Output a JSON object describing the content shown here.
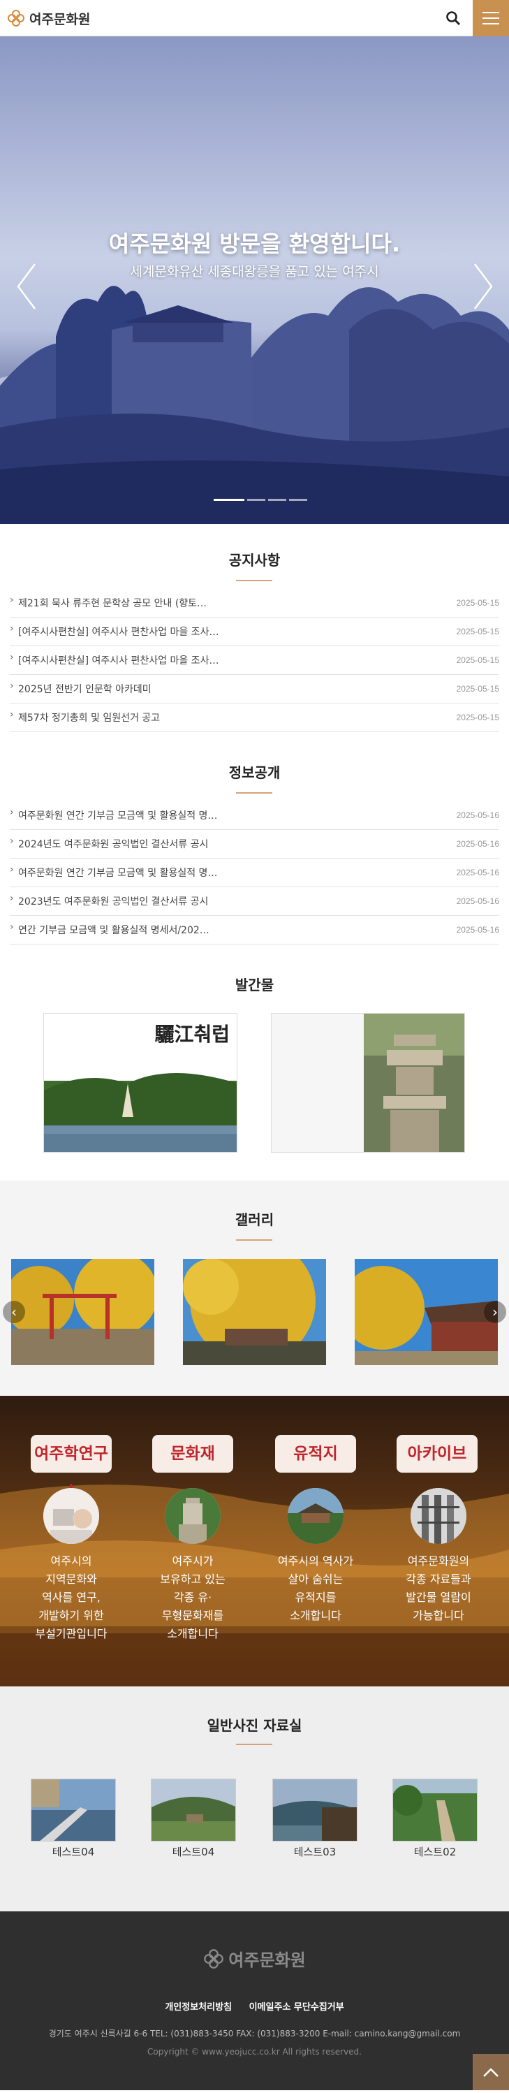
{
  "header": {
    "logo_text": "여주문화원"
  },
  "hero": {
    "title": "여주문화원 방문을 환영합니다.",
    "subtitle": "세계문화유산 세종대왕릉을 품고 있는 여주시"
  },
  "notice": {
    "title": "공지사항",
    "items": [
      {
        "t": "제21회 묵사 류주현 문학상 공모 안내 (향토…",
        "d": "2025-05-15"
      },
      {
        "t": "[여주시사편찬실] 여주시사 편찬사업 마을 조사…",
        "d": "2025-05-15"
      },
      {
        "t": "[여주시사편찬실] 여주시사 편찬사업 마을 조사…",
        "d": "2025-05-15"
      },
      {
        "t": "2025년 전반기 인문학 아카데미",
        "d": "2025-05-15"
      },
      {
        "t": "제57차 정기총회 및 임원선거 공고",
        "d": "2025-05-15"
      }
    ]
  },
  "info": {
    "title": "정보공개",
    "items": [
      {
        "t": "여주문화원 연간 기부금 모금액 및 활용실적 명…",
        "d": "2025-05-16"
      },
      {
        "t": "2024년도 여주문화원 공익법인 결산서류 공시",
        "d": "2025-05-16"
      },
      {
        "t": "여주문화원 연간 기부금 모금액 및 활용실적 명…",
        "d": "2025-05-16"
      },
      {
        "t": "2023년도 여주문화원 공익법인 결산서류 공시",
        "d": "2025-05-16"
      },
      {
        "t": "연간 기부금 모금액 및 활용실적 명세서/202…",
        "d": "2025-05-16"
      }
    ]
  },
  "pubs": {
    "title": "발간물",
    "cover_title": "驪江춰럽"
  },
  "gallery": {
    "title": "갤러리"
  },
  "categories": [
    {
      "label": "여주학연구소",
      "desc": "여주시의\n지역문화와\n역사를 연구,\n개발하기 위한\n부설기관입니다"
    },
    {
      "label": "문화재",
      "desc": "여주시가\n보유하고 있는\n각종 유·\n무형문화재를\n소개합니다"
    },
    {
      "label": "유적지",
      "desc": "여주시의 역사가\n살아 숨쉬는\n유적지를\n소개합니다"
    },
    {
      "label": "아카이브",
      "desc": "여주문화원의\n각종 자료들과\n발간물 열람이\n가능합니다"
    }
  ],
  "photos": {
    "title": "일반사진 자료실",
    "items": [
      {
        "label": "테스트04"
      },
      {
        "label": "테스트04"
      },
      {
        "label": "테스트03"
      },
      {
        "label": "테스트02"
      }
    ]
  },
  "footer": {
    "logo_text": "여주문화원",
    "link1": "개인정보처리방침",
    "link2": "이메일주소 무단수집거부",
    "address": "경기도 여주시 신륵사길 6-6   TEL: (031)883-3450   FAX: (031)883-3200   E-mail: camino.kang@gmail.com",
    "copyright": "Copyright © www.yeojucc.co.kr All rights reserved."
  },
  "colors": {
    "accent": "#c9914f",
    "category_text": "#c0252b"
  }
}
